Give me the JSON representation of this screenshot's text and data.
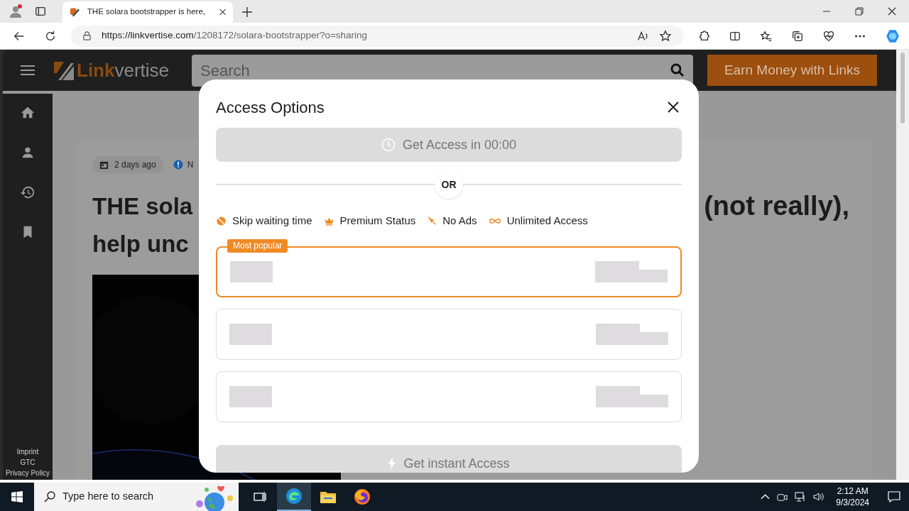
{
  "browser": {
    "tab": {
      "title": "THE solara bootstrapper is here,"
    },
    "url": {
      "host": "https://linkvertise.com",
      "path": "/1208172/solara-bootstrapper?o=sharing"
    }
  },
  "site": {
    "logo": {
      "part_1": "Link",
      "part_2": "vertise"
    },
    "search": {
      "placeholder": "Search"
    },
    "cta": "Earn Money with Links",
    "sidebar": {
      "items": [
        {
          "kind": "home"
        },
        {
          "kind": "user"
        },
        {
          "kind": "history"
        },
        {
          "kind": "bookmark"
        }
      ],
      "footer_links": [
        "Imprint",
        "GTC",
        "Privacy Policy"
      ]
    },
    "article": {
      "date": "2 days ago",
      "badge": "N",
      "title_lines": [
        "THE sola",
        "help unc"
      ],
      "title_right": "(not really),"
    }
  },
  "modal": {
    "title": "Access Options",
    "timer_button": {
      "label": "Get Access in 00:00",
      "disabled": true
    },
    "divider": "OR",
    "features": [
      {
        "kind": "skip",
        "label": "Skip waiting time"
      },
      {
        "kind": "crown",
        "label": "Premium Status"
      },
      {
        "kind": "noads",
        "label": "No Ads"
      },
      {
        "kind": "infinity",
        "label": "Unlimited Access"
      }
    ],
    "plans": [
      {
        "selected": true,
        "badge": "Most popular"
      },
      {
        "selected": false
      },
      {
        "selected": false
      }
    ],
    "instant_button": {
      "label": "Get instant Access",
      "disabled": true
    }
  },
  "taskbar": {
    "search": {
      "placeholder": "Type here to search"
    },
    "time": "2:12 AM",
    "date": "9/3/2024"
  }
}
